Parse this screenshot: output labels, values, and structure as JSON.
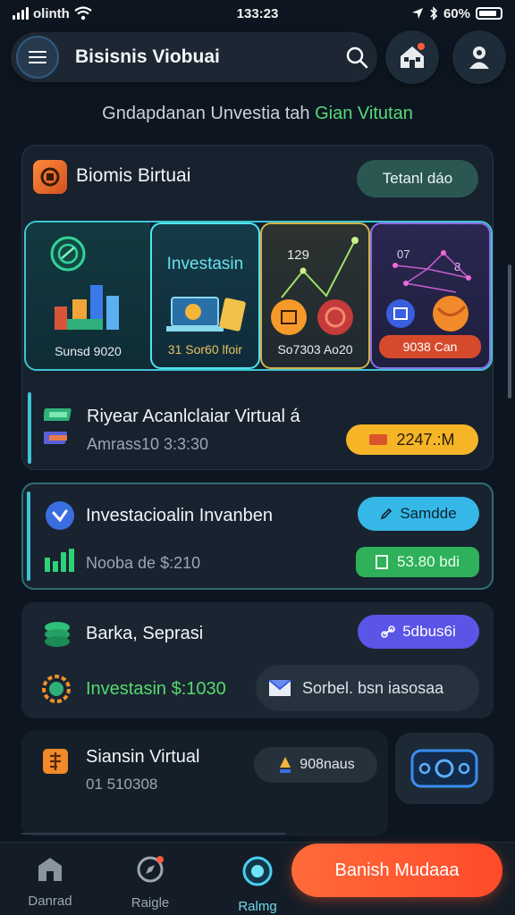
{
  "status_bar": {
    "carrier": "olinth",
    "time": "133:23",
    "battery": "60%"
  },
  "header": {
    "title": "Bisisnis Viobuai"
  },
  "subtitle": {
    "main": "Gndapdanan Unvestia tah ",
    "highlight": "Gian Vitutan"
  },
  "main_card": {
    "title": "Biomis Birtuai",
    "action": "Tetanl dáo",
    "tiles": [
      {
        "caption": "Sunsd 9020"
      },
      {
        "heading": "Investasin",
        "caption": "31 Sor60 lfoir"
      },
      {
        "number": "129",
        "caption": "So7303 Ao20"
      },
      {
        "num_a": "07",
        "num_b": "8",
        "badge": "9038 Can"
      }
    ],
    "row_title": "Riyear Acanlclaiar Virtual á",
    "row_sub": "Amrass10 3:3:30",
    "row_value": "2247.:M"
  },
  "card2": {
    "title": "Investacioalin Invanben",
    "sub": "Nooba de $:210",
    "action": "Samdde",
    "value": "53.80 bdi"
  },
  "card3": {
    "title": "Barka, Seprasi",
    "invest": "Investasin $:1030",
    "action": "5dbus6i",
    "box_text": "Sorbel. bsn iasosaa"
  },
  "card4": {
    "title": "Siansin Virtual",
    "sub": "01 510308",
    "pill": "908naus"
  },
  "nav": {
    "items": [
      {
        "label": "Danrad"
      },
      {
        "label": "Raigle"
      },
      {
        "label": "Ralmg"
      }
    ],
    "cta": "Banish Mudaaa"
  },
  "colors": {
    "accent_teal": "#3fc4d6",
    "accent_orange": "#ff5a2e",
    "accent_green": "#55d96f",
    "accent_purple": "#5a55e6"
  }
}
